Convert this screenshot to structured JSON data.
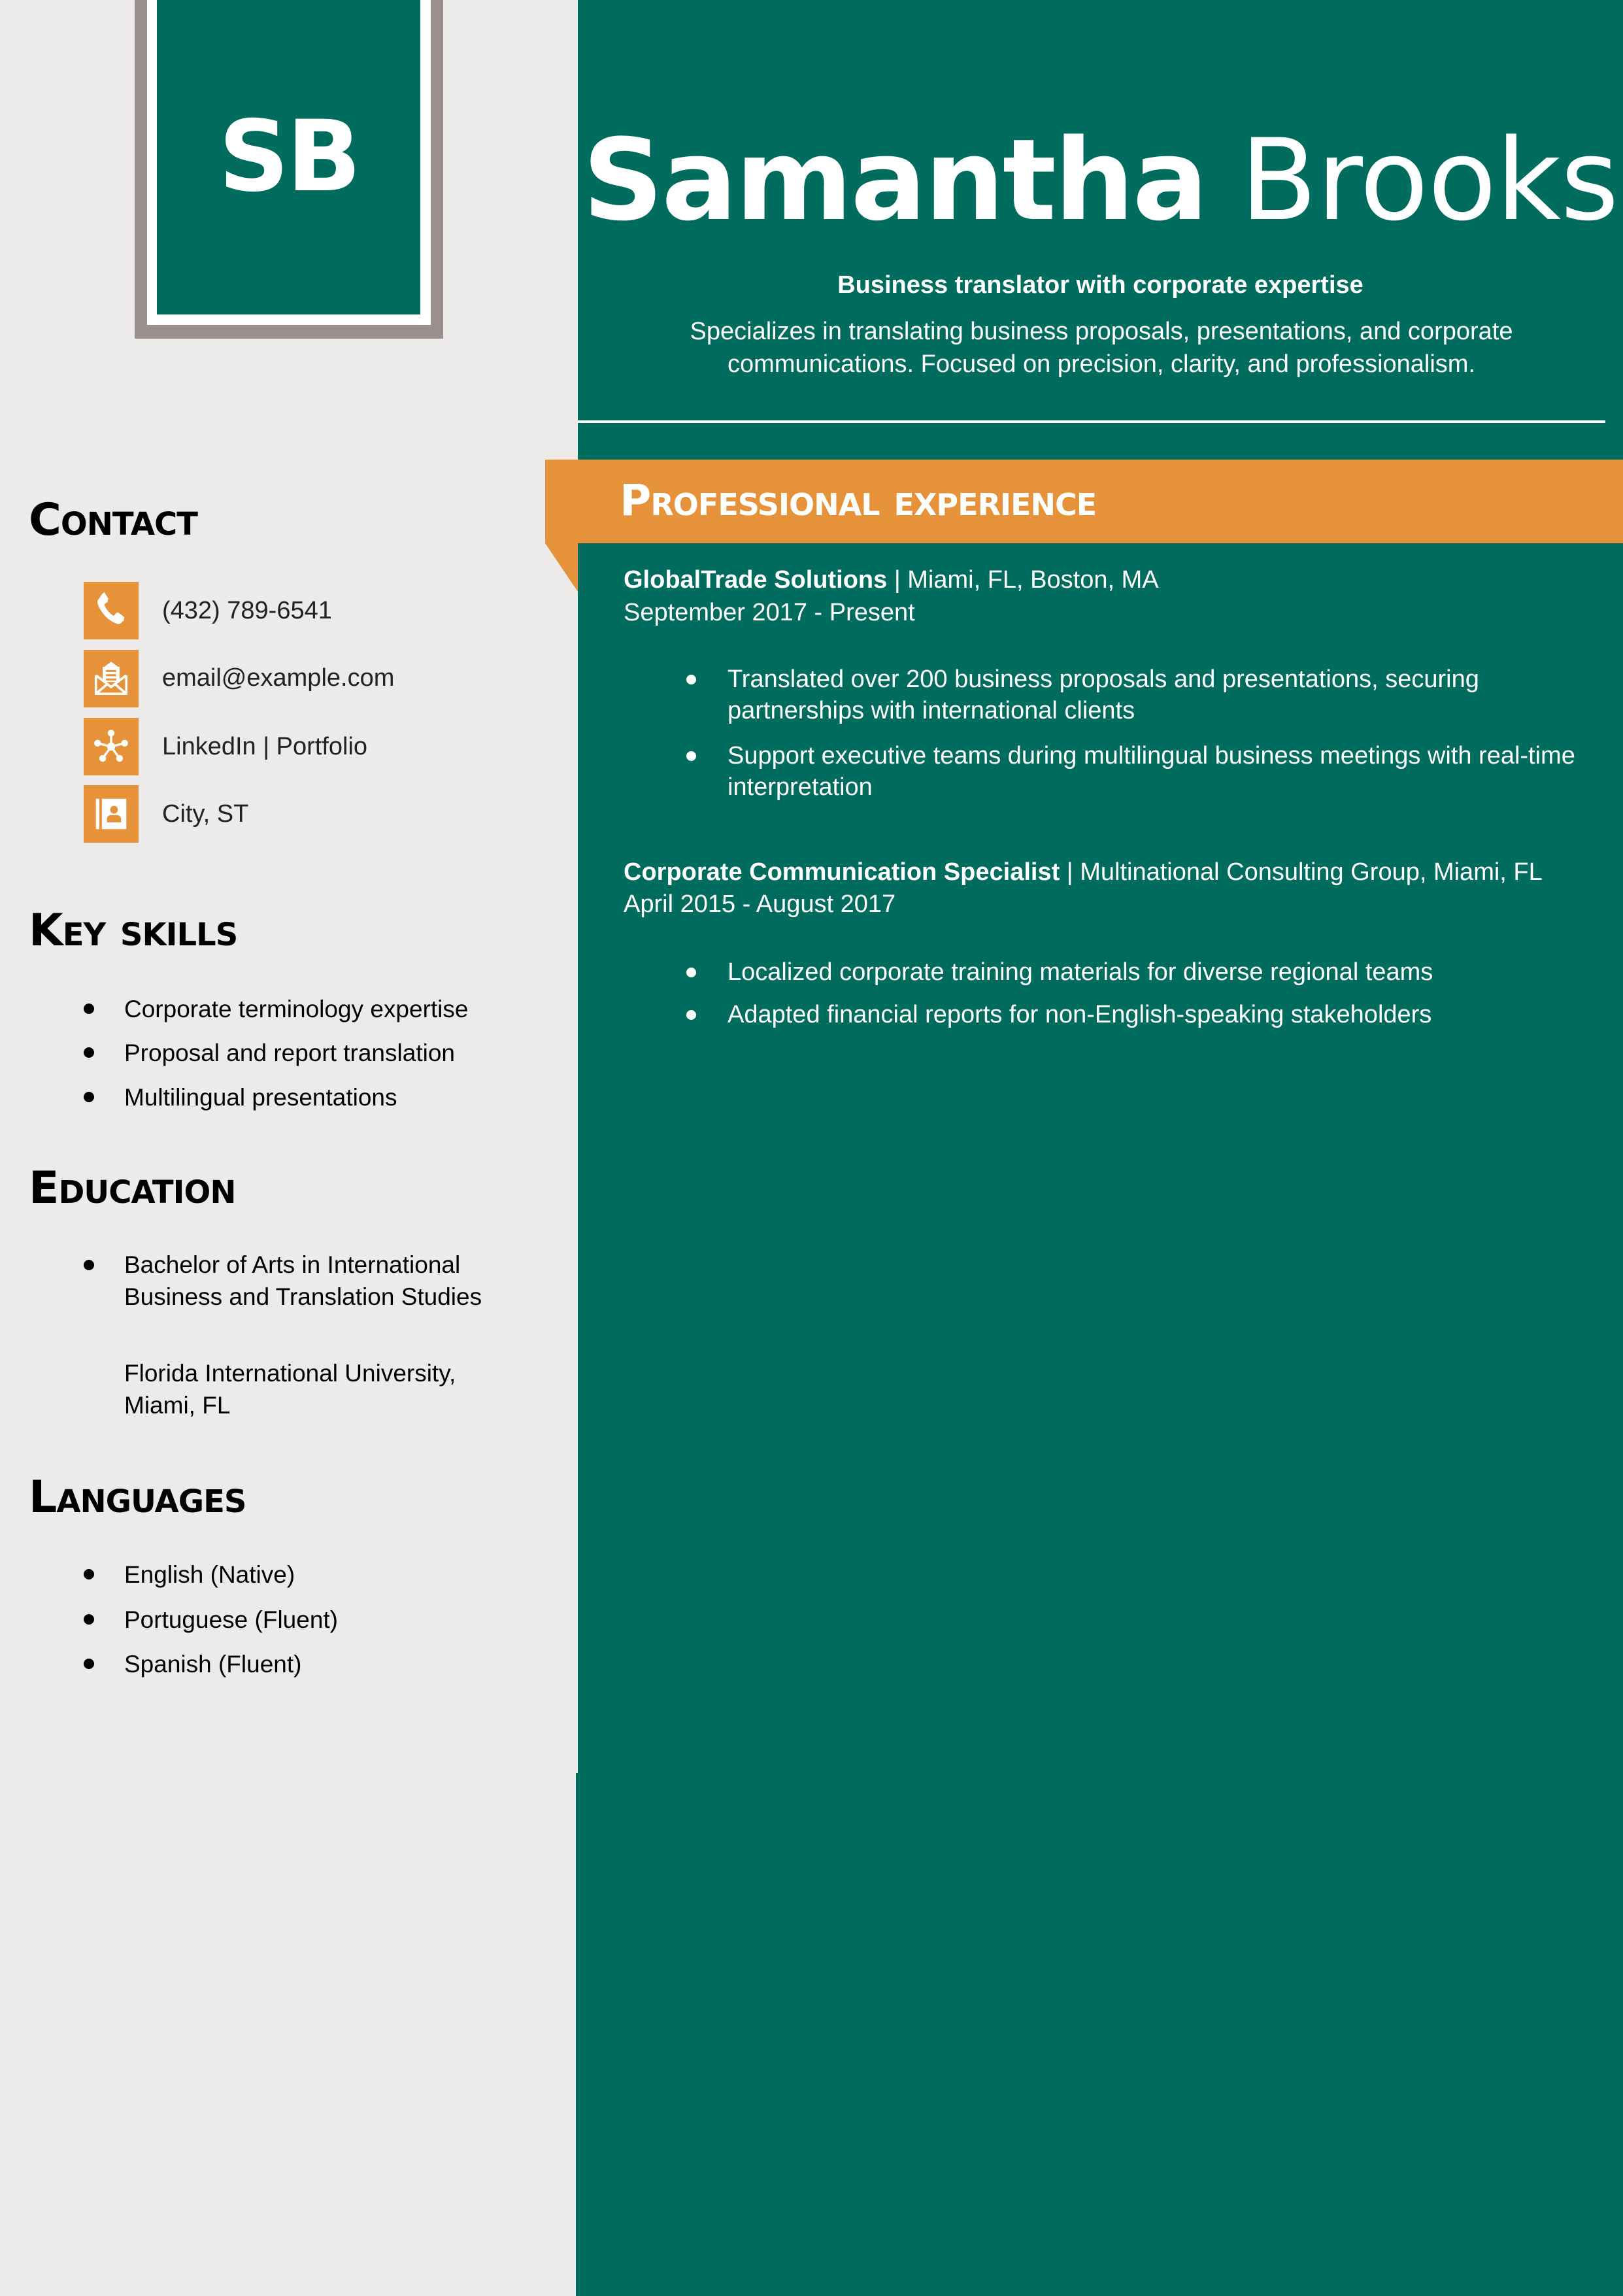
{
  "monogram": "SB",
  "header": {
    "first_name": "Samantha",
    "last_name": "Brooks",
    "tagline": "Business translator with corporate expertise",
    "summary": "Specializes in translating business proposals, presentations, and corporate communications. Focused on precision, clarity, and professionalism."
  },
  "contact": {
    "heading": "Contact",
    "items": [
      {
        "icon": "phone-icon",
        "text": "(432) 789-6541"
      },
      {
        "icon": "envelope-icon",
        "text": "email@example.com"
      },
      {
        "icon": "network-icon",
        "text": "LinkedIn | Portfolio"
      },
      {
        "icon": "address-book-icon",
        "text": "City, ST"
      }
    ]
  },
  "skills": {
    "heading": "Key skills",
    "items": [
      "Corporate terminology expertise",
      "Proposal and report translation",
      "Multilingual presentations"
    ]
  },
  "education": {
    "heading": "Education",
    "degree": "Bachelor of Arts in International Business and Translation Studies",
    "school": "Florida International University, Miami, FL"
  },
  "languages": {
    "heading": "Languages",
    "items": [
      "English (Native)",
      "Portuguese (Fluent)",
      "Spanish (Fluent)"
    ]
  },
  "experience": {
    "heading": "Professional experience",
    "jobs": [
      {
        "title": "GlobalTrade Solutions",
        "details": " | Miami, FL, Boston, MA",
        "dates": "September 2017 - Present",
        "bullets": [
          "Translated over 200 business proposals and presentations, securing partnerships with international clients",
          "Support executive teams during multilingual business meetings with real-time interpretation"
        ]
      },
      {
        "title": "Corporate Communication Specialist",
        "details": " | Multinational Consulting Group, Miami, FL",
        "dates": "April 2015 - August 2017",
        "bullets": [
          "Localized corporate training materials for diverse regional teams",
          "Adapted financial reports for non-English-speaking stakeholders"
        ]
      }
    ]
  },
  "colors": {
    "primary_green": "#006C5E",
    "accent_orange": "#E6923A",
    "sidebar_bg": "#ECEBE9",
    "frame_gray": "#9A8F8D"
  }
}
